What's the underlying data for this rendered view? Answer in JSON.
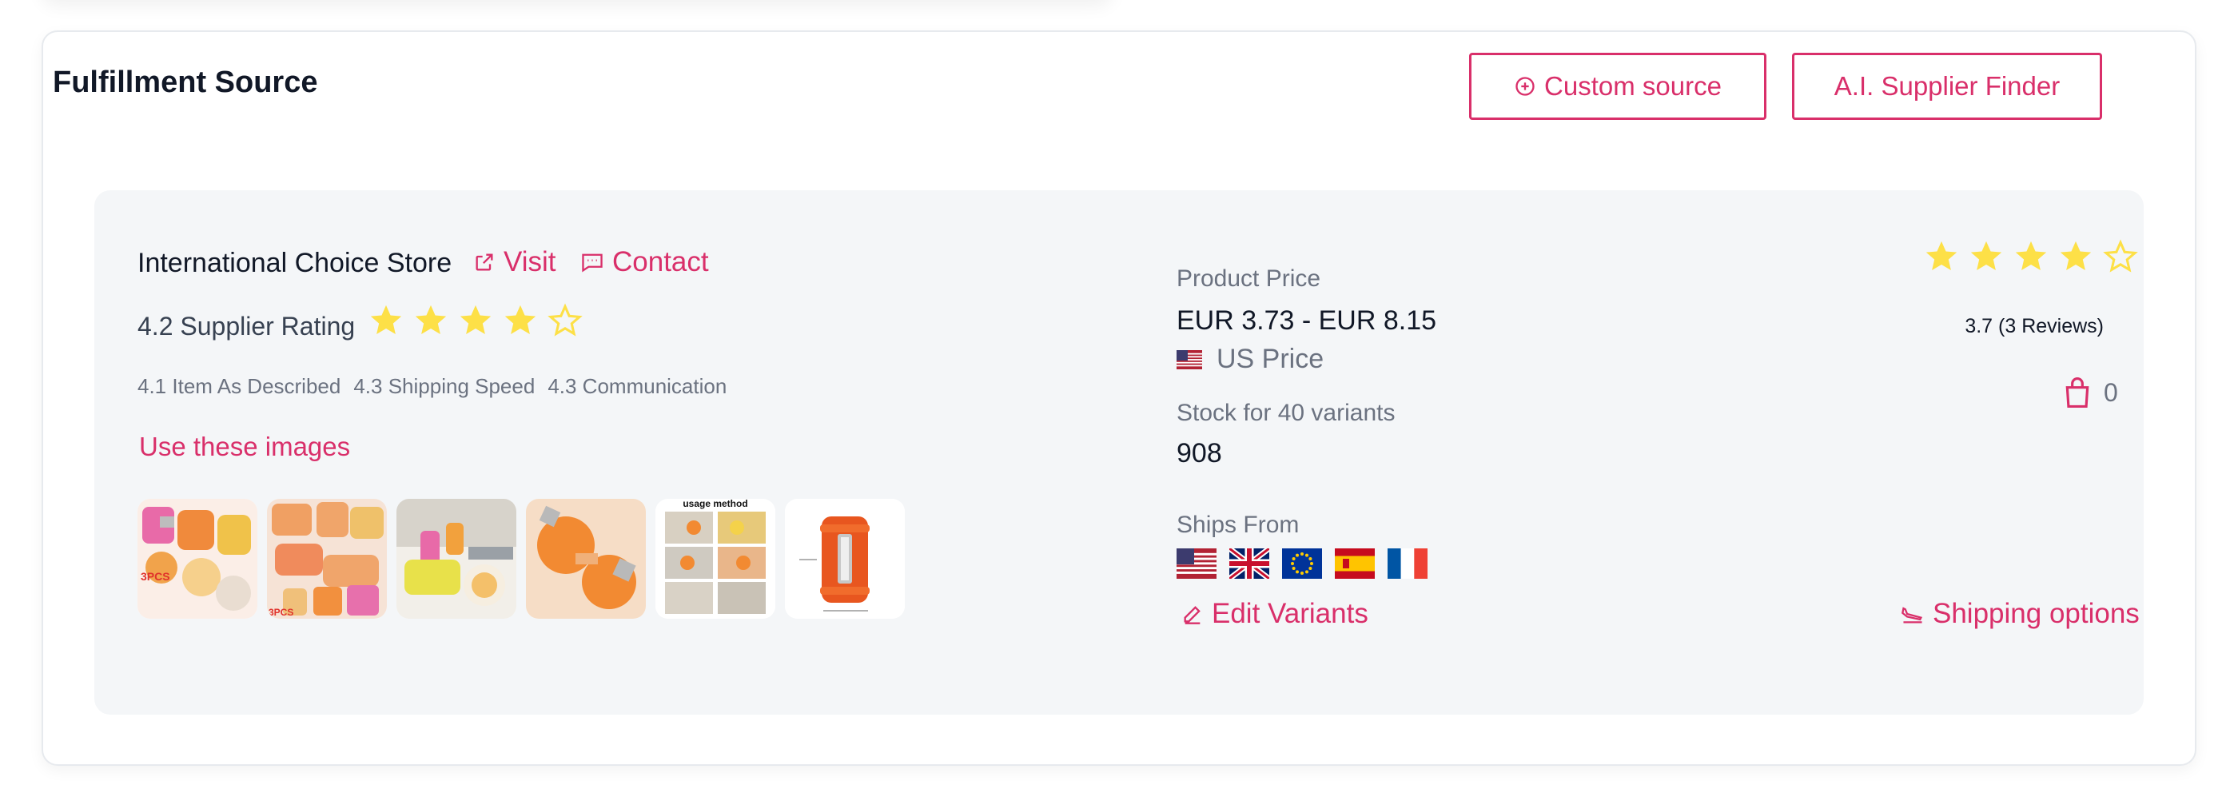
{
  "section": {
    "title": "Fulfillment Source",
    "custom_source_label": "Custom source",
    "ai_finder_label": "A.I. Supplier Finder"
  },
  "supplier": {
    "name": "International Choice Store",
    "visit_label": "Visit",
    "contact_label": "Contact",
    "rating_text": "4.2 Supplier Rating",
    "rating_value": 4.2,
    "sub_ratings": [
      "4.1 Item As Described",
      "4.3 Shipping Speed",
      "4.3 Communication"
    ],
    "use_images_label": "Use these images",
    "thumbnail_count": 6,
    "thumbnail_texts": {
      "badge": "3PCS",
      "usage": "usage method"
    }
  },
  "product": {
    "price_label": "Product Price",
    "price_value": "EUR 3.73 - EUR 8.15",
    "us_price_label": "US Price",
    "stock_label": "Stock for 40 variants",
    "stock_value": "908",
    "ships_from_label": "Ships From",
    "ships_from": [
      "US",
      "UK",
      "EU",
      "ES",
      "FR"
    ],
    "rating_value": 3.7,
    "reviews_text": "3.7 (3 Reviews)",
    "bag_count": "0",
    "edit_variants_label": "Edit Variants",
    "shipping_options_label": "Shipping options"
  },
  "colors": {
    "accent": "#d92f6a",
    "star": "#fde047",
    "card_bg": "#f4f6f8",
    "muted_text": "#6b7280"
  },
  "icons": {
    "custom_source": "plus-circle-icon",
    "visit": "external-link-icon",
    "contact": "message-icon",
    "edit": "pencil-icon",
    "shipping": "plane-landing-icon",
    "bag": "shopping-bag-icon"
  }
}
